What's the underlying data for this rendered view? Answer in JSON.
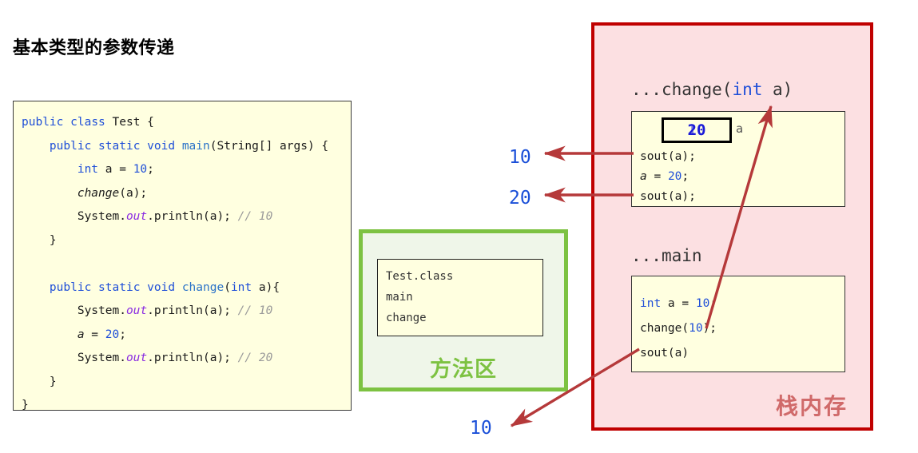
{
  "page": {
    "title": "基本类型的参数传递",
    "bg": "#ffffff"
  },
  "code_block": {
    "bg": "#FFFFE0",
    "border": "#3a3a3a",
    "lines": [
      "public class Test {",
      "    public static void main(String[] args) {",
      "        int a = 10;",
      "        change(a);",
      "        System.out.println(a); // 10",
      "    }",
      "",
      "    public static void change(int a){",
      "        System.out.println(a); // 10",
      "        a = 20;",
      "        System.out.println(a); // 20",
      "    }",
      "}"
    ],
    "tokens": {
      "keywords": [
        "public",
        "class",
        "static",
        "void",
        "int"
      ],
      "numbers": [
        "10",
        "20"
      ],
      "comments": [
        "// 10",
        "// 20"
      ],
      "field": "out",
      "methods": [
        "change"
      ],
      "colors": {
        "keyword": "#1f4fd8",
        "number": "#1f4fd8",
        "comment": "#9a9a9a",
        "field": "#8a2be2",
        "text": "#1a1a1a"
      }
    }
  },
  "method_area": {
    "label": "方法区",
    "label_color": "#7DC242",
    "border_color": "#7DC242",
    "bg": "#EFF6E9",
    "inner_bg": "#FFFFE0",
    "entries": [
      "Test.class",
      "main",
      "change"
    ]
  },
  "stack_memory": {
    "label": "栈内存",
    "label_color": "#D06A6A",
    "border_color": "#C00000",
    "bg": "#FCE0E2",
    "frames": [
      {
        "title_prefix": "...",
        "title_method": "change(",
        "title_type": "int",
        "title_arg": " a)",
        "variable": {
          "name": "a",
          "old_value": "10",
          "new_value": "20",
          "value_color": "#1a1ad8"
        },
        "lines": [
          {
            "text": "sout(a);",
            "parts": [
              {
                "t": "sout(a);",
                "c": "plain"
              }
            ]
          },
          {
            "text": "a = 20;",
            "parts": [
              {
                "t": "a",
                "c": "italic"
              },
              {
                "t": " = ",
                "c": "plain"
              },
              {
                "t": "20",
                "c": "num"
              },
              {
                "t": ";",
                "c": "plain"
              }
            ]
          },
          {
            "text": "sout(a);",
            "parts": [
              {
                "t": "sout(a);",
                "c": "plain"
              }
            ]
          }
        ]
      },
      {
        "title_prefix": "...",
        "title_method": "main",
        "title_type": "",
        "title_arg": "",
        "lines": [
          {
            "text": "int a = 10;",
            "parts": [
              {
                "t": "int",
                "c": "kw"
              },
              {
                "t": " a = ",
                "c": "plain"
              },
              {
                "t": "10",
                "c": "num"
              },
              {
                "t": ";",
                "c": "plain"
              }
            ]
          },
          {
            "text": "change(10);",
            "parts": [
              {
                "t": "change(",
                "c": "plain"
              },
              {
                "t": "10",
                "c": "num"
              },
              {
                "t": ");",
                "c": "plain"
              }
            ]
          },
          {
            "text": "sout(a)",
            "parts": [
              {
                "t": "sout(a)",
                "c": "plain"
              }
            ]
          }
        ]
      }
    ]
  },
  "annotations": {
    "arrow_color": "#B5393A",
    "text_color": "#1a4fd8",
    "items": [
      {
        "name": "output-10-from-change-first-sout",
        "value": "10"
      },
      {
        "name": "output-20-from-change-second-sout",
        "value": "20"
      },
      {
        "name": "output-10-from-main-sout",
        "value": "10"
      }
    ]
  }
}
